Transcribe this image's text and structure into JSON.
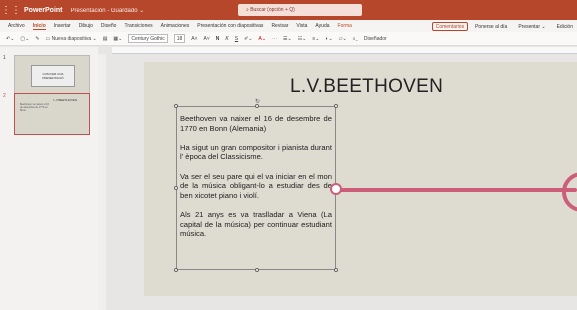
{
  "titlebar": {
    "app_name": "PowerPoint",
    "doc_name": "Presentación - Guardado ⌄",
    "search_placeholder": "Buscar (opción + Q)"
  },
  "tabs": [
    "Archivo",
    "Inicio",
    "Insertar",
    "Dibujo",
    "Diseño",
    "Transiciones",
    "Animaciones",
    "Presentación con diapositivas",
    "Revisar",
    "Vista",
    "Ayuda",
    "Forma"
  ],
  "tabs_right": {
    "comments": "Comentarios",
    "catch_up": "Ponerse al día",
    "present": "Presentar ⌄",
    "edit": "Edición"
  },
  "ribbon": {
    "new_slide": "Nueva diapositiva ⌄",
    "font_name": "Century Gothic",
    "font_size": "18",
    "bold": "N",
    "italic": "K",
    "underline": "S",
    "designer": "Diseñador"
  },
  "thumbnails": {
    "slide1_num": "1",
    "slide1_text": "COM FER UNA PRESENTACIÓ",
    "slide2_num": "2",
    "slide2_title": "L.V.BEETHOVEN",
    "slide2_lines": "Beethoven va naixer el 16 de desembre de 1770 en Bonn"
  },
  "slide": {
    "title": "L.V.BEETHOVEN",
    "paragraphs": [
      "Beethoven va naixer el 16 de desembre de 1770 en Bonn (Alemania)",
      "Ha sigut un gran compositor i pianista durant l' època del Classicisme.",
      "Va ser el seu pare qui el va iniciar en el mon de la música obligant-lo a estudiar des de ben xicotet piano i violí.",
      "Als 21 anys es va traslladar a Viena (La capital de la música) per continuar estudiant música."
    ]
  },
  "colors": {
    "brand": "#b7472a",
    "connector": "#cc5e7a"
  }
}
